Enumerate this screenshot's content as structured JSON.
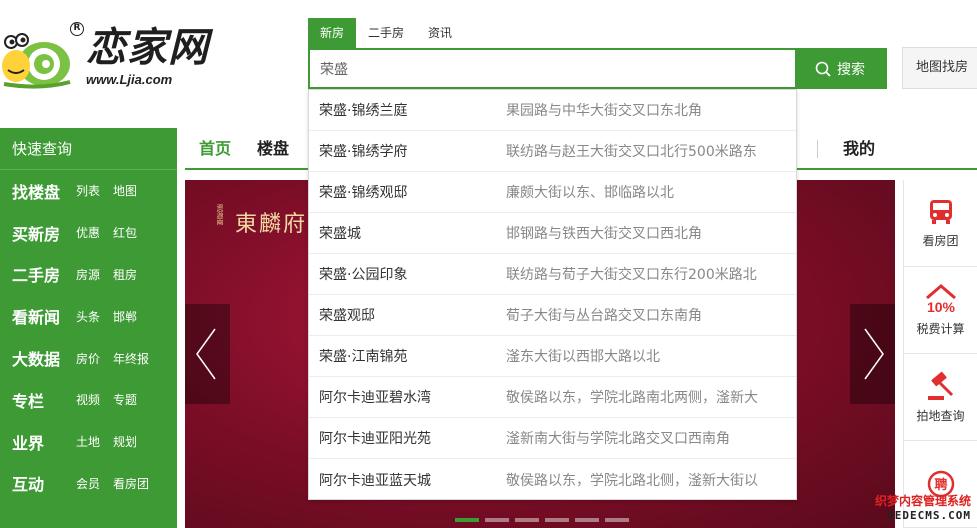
{
  "logo": {
    "brand": "恋家网",
    "url": "www.Ljia.com",
    "reg": "R"
  },
  "search": {
    "tabs": [
      "新房",
      "二手房",
      "资讯"
    ],
    "active_tab": "新房",
    "value": "荣盛",
    "button_label": "搜索",
    "map_label": "地图找房"
  },
  "sidebar": {
    "header": "快速查询",
    "rows": [
      {
        "main": "找楼盘",
        "subs": [
          "列表",
          "地图"
        ]
      },
      {
        "main": "买新房",
        "subs": [
          "优惠",
          "红包"
        ]
      },
      {
        "main": "二手房",
        "subs": [
          "房源",
          "租房"
        ]
      },
      {
        "main": "看新闻",
        "subs": [
          "头条",
          "邯郸"
        ]
      },
      {
        "main": "大数据",
        "subs": [
          "房价",
          "年终报"
        ]
      },
      {
        "main": "专栏",
        "subs": [
          "视频",
          "专题"
        ]
      },
      {
        "main": "业界",
        "subs": [
          "土地",
          "规划"
        ]
      },
      {
        "main": "互动",
        "subs": [
          "会员",
          "看房团"
        ]
      }
    ]
  },
  "nav": {
    "items": [
      "首页",
      "楼盘",
      "我的"
    ],
    "active": "首页",
    "accent": "#3e9a35"
  },
  "banner": {
    "title": "東麟府",
    "mini": "资源兩"
  },
  "tools": [
    {
      "label": "看房团",
      "icon": "bus-icon"
    },
    {
      "label": "税费计算",
      "icon": "percent-house-icon"
    },
    {
      "label": "拍地查询",
      "icon": "auction-hammer-icon"
    },
    {
      "label": "",
      "icon": "recruit-icon",
      "icon_text": "聘"
    }
  ],
  "suggestions": [
    {
      "name": "荣盛·锦绣兰庭",
      "address": "果园路与中华大街交叉口东北角"
    },
    {
      "name": "荣盛·锦绣学府",
      "address": "联纺路与赵王大街交叉口北行500米路东"
    },
    {
      "name": "荣盛·锦绣观邸",
      "address": "廉颇大街以东、邯临路以北"
    },
    {
      "name": "荣盛城",
      "address": "邯钢路与铁西大街交叉口西北角"
    },
    {
      "name": "荣盛·公园印象",
      "address": "联纺路与荀子大街交叉口东行200米路北"
    },
    {
      "name": "荣盛观邸",
      "address": "荀子大街与丛台路交叉口东南角"
    },
    {
      "name": "荣盛·江南锦苑",
      "address": "滏东大街以西邯大路以北"
    },
    {
      "name": "阿尔卡迪亚碧水湾",
      "address": "敬侯路以东，学院北路南北两侧，滏新大"
    },
    {
      "name": "阿尔卡迪亚阳光苑",
      "address": "滏新南大街与学院北路交叉口西南角"
    },
    {
      "name": "阿尔卡迪亚蓝天城",
      "address": "敬侯路以东，学院北路北侧，滏新大街以"
    }
  ],
  "watermark": {
    "line1": "织梦内容管理系统",
    "line2": "DEDECMS.COM"
  }
}
